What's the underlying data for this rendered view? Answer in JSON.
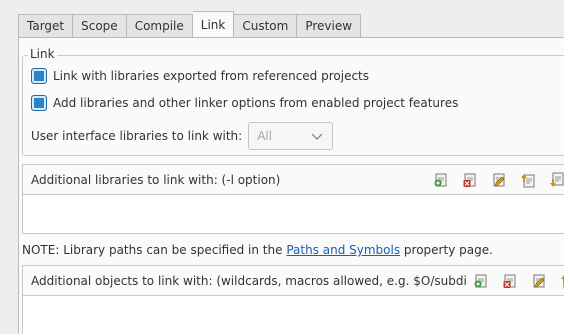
{
  "tabs": [
    {
      "label": "Target",
      "active": false
    },
    {
      "label": "Scope",
      "active": false
    },
    {
      "label": "Compile",
      "active": false
    },
    {
      "label": "Link",
      "active": true
    },
    {
      "label": "Custom",
      "active": false
    },
    {
      "label": "Preview",
      "active": false
    }
  ],
  "link_group": {
    "legend": "Link",
    "check_exported": {
      "label": "Link with libraries exported from referenced projects",
      "checked": true
    },
    "check_features": {
      "label": "Add libraries and other linker options from enabled project features",
      "checked": true
    },
    "ui_libs": {
      "label": "User interface libraries to link with:",
      "value": "All"
    }
  },
  "libraries_list": {
    "header": "Additional libraries to link with: (-l option)",
    "tools": [
      "add-icon",
      "delete-icon",
      "edit-icon",
      "move-up-icon",
      "move-down-icon"
    ]
  },
  "note": {
    "prefix": "NOTE: Library paths can be specified in the ",
    "link": "Paths and Symbols",
    "suffix": " property page."
  },
  "objects_list": {
    "header": "Additional objects to link with: (wildcards, macros allowed, e.g. $O/subdi",
    "tools": [
      "add-icon",
      "delete-icon",
      "edit-icon",
      "move-up-icon"
    ]
  },
  "colors": {
    "accent": "#2a83c9",
    "link": "#1a5fb4"
  }
}
